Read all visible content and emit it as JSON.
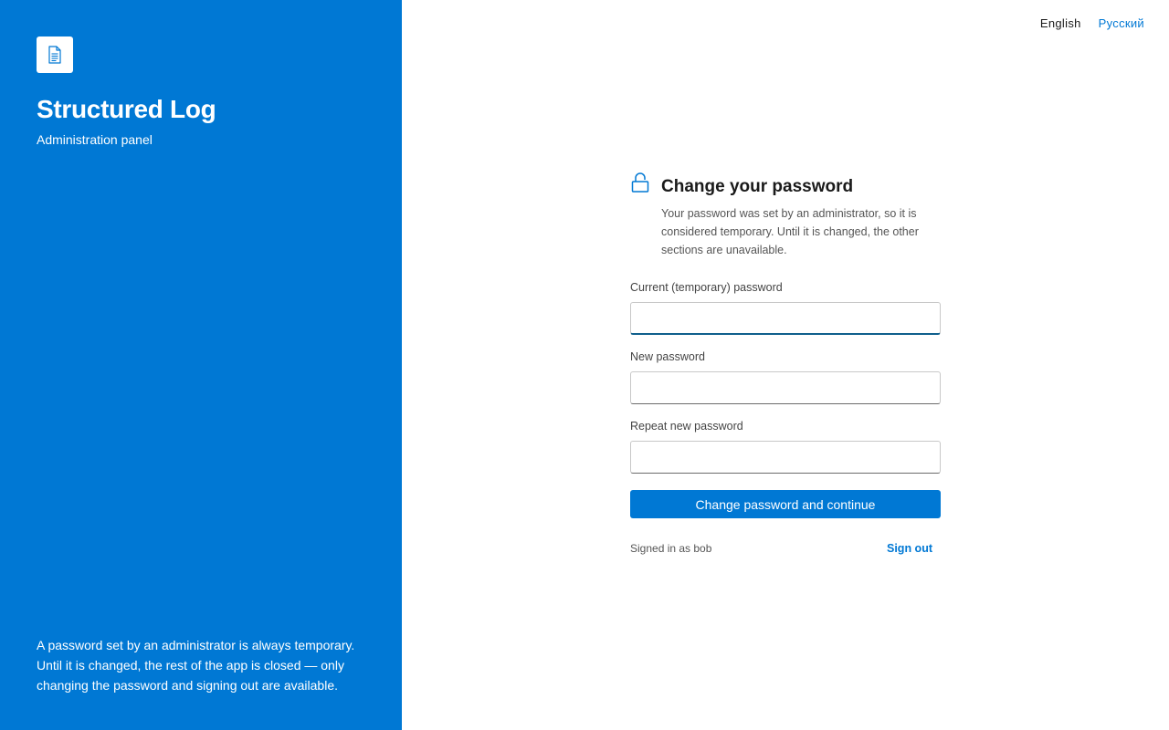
{
  "sidebar": {
    "logo_icon": "document-icon",
    "title": "Structured Log",
    "subtitle": "Administration panel",
    "note": "A password set by an administrator is always temporary. Until it is changed, the rest of the app is closed — only changing the password and signing out are available."
  },
  "language": {
    "options": [
      {
        "label": "English",
        "active": true
      },
      {
        "label": "Русский",
        "active": false
      }
    ]
  },
  "form": {
    "icon": "lock-icon",
    "heading": "Change your password",
    "description": "Your password was set by an administrator, so it is considered temporary. Until it is changed, the other sections are unavailable.",
    "fields": [
      {
        "label": "Current (temporary) password",
        "value": "",
        "placeholder": ""
      },
      {
        "label": "New password",
        "value": "",
        "placeholder": ""
      },
      {
        "label": "Repeat new password",
        "value": "",
        "placeholder": ""
      }
    ],
    "submit_label": "Change password and continue",
    "signed_in_text": "Signed in as bob",
    "sign_out_label": "Sign out"
  },
  "colors": {
    "accent": "#0078d4",
    "background": "#ffffff",
    "text": "#1a1a1a"
  }
}
